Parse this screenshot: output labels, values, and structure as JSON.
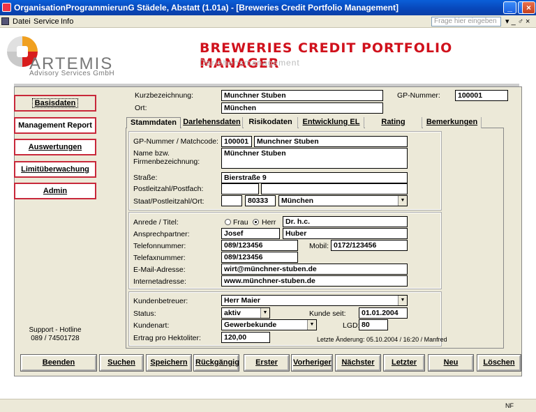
{
  "window": {
    "title": "OrganisationProgrammierunG Städele, Abstatt (1.01a) - [Breweries Credit Portfolio Management]"
  },
  "menu": {
    "items": [
      "Datei",
      "Service",
      "Info"
    ],
    "help_placeholder": "Frage hier eingeben",
    "right_controls": "▾ _ ♂ ×"
  },
  "header": {
    "logo_text": "ARTEMIS",
    "logo_sub": "Advisory Services GmbH",
    "title": "BREWERIES CREDIT PORTFOLIO MANAGER",
    "subtitle": "Darlehensmanagement"
  },
  "nav": {
    "items": [
      "Basisdaten",
      "Management Report",
      "Auswertungen",
      "Limitüberwachung",
      "Admin"
    ]
  },
  "hotline": {
    "line1": "Support - Hotline",
    "line2": "089 / 74501728"
  },
  "top": {
    "kurz_label": "Kurzbezeichnung:",
    "kurz_value": "Munchner Stuben",
    "ort_label": "Ort:",
    "ort_value": "München",
    "gp_label": "GP-Nummer:",
    "gp_value": "100001"
  },
  "tabs": [
    "Stammdaten",
    "Darlehensdaten",
    "Risikodaten",
    "Entwicklung EL",
    "Rating",
    "Bemerkungen"
  ],
  "form": {
    "gp_label": "GP-Nummer / Matchcode:",
    "gp_value": "100001",
    "matchcode": "Munchner Stuben",
    "name_label1": "Name bzw.",
    "name_label2": "Firmenbezeichnung:",
    "name_value": "Münchner Stuben",
    "strasse_label": "Straße:",
    "strasse_value": "Bierstraße 9",
    "plz_label": "Postleitzahl/Postfach:",
    "plz_value": "",
    "postfach_value": "",
    "staat_label": "Staat/Postleitzahl/Ort:",
    "staat_value": "",
    "plz2_value": "80333",
    "ort_value": "München",
    "anrede_label": "Anrede / Titel:",
    "frau": "Frau",
    "herr": "Herr",
    "titel_value": "Dr. h.c.",
    "ansprech_label": "Ansprechpartner:",
    "vorname": "Josef",
    "nachname": "Huber",
    "tel_label": "Telefonnummer:",
    "tel_value": "089/123456",
    "mobil_label": "Mobil:",
    "mobil_value": "0172/123456",
    "fax_label": "Telefaxnummer:",
    "fax_value": "089/123456",
    "mail_label": "E-Mail-Adresse:",
    "mail_value": "wirt@münchner-stuben.de",
    "web_label": "Internetadresse:",
    "web_value": "www.münchner-stuben.de",
    "betreuer_label": "Kundenbetreuer:",
    "betreuer_value": "Herr Maier",
    "status_label": "Status:",
    "status_value": "aktiv",
    "seit_label": "Kunde seit:",
    "seit_value": "01.01.2004",
    "art_label": "Kundenart:",
    "art_value": "Gewerbekunde",
    "lgd_label": "LGD:",
    "lgd_value": "80",
    "ertrag_label": "Ertrag pro Hektoliter:",
    "ertrag_value": "120,00",
    "last_change": "Letzte Änderung: 05.10.2004 / 16:20 / Manfred"
  },
  "buttons": [
    "Beenden",
    "Suchen",
    "Speichern",
    "Rückgängig",
    "Erster",
    "Vorheriger",
    "Nächster",
    "Letzter",
    "Neu",
    "Löschen"
  ],
  "status": {
    "text": "NF"
  }
}
